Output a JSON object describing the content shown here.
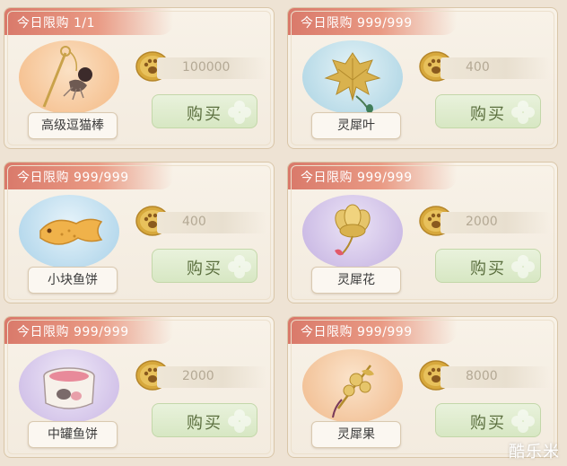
{
  "colors": {
    "ribbon": "#d9796a",
    "buy_button": "#d7e7c3",
    "coin": "#d7a83c",
    "price_text": "#b4a995"
  },
  "buy_label": "购买",
  "items": [
    {
      "limit": "今日限购 1/1",
      "name": "高级逗猫棒",
      "price": "100000",
      "icon": "cat-teaser-wand-icon",
      "bg": "#f6c79a"
    },
    {
      "limit": "今日限购 999/999",
      "name": "灵犀叶",
      "price": "400",
      "icon": "golden-leaf-icon",
      "bg": "#b9dbe7"
    },
    {
      "limit": "今日限购 999/999",
      "name": "小块鱼饼",
      "price": "400",
      "icon": "fish-cake-icon",
      "bg": "#bcdcec"
    },
    {
      "limit": "今日限购 999/999",
      "name": "灵犀花",
      "price": "2000",
      "icon": "golden-flower-icon",
      "bg": "#cbbbe3"
    },
    {
      "limit": "今日限购 999/999",
      "name": "中罐鱼饼",
      "price": "2000",
      "icon": "fish-can-icon",
      "bg": "#d2c3e8"
    },
    {
      "limit": "今日限购 999/999",
      "name": "灵犀果",
      "price": "8000",
      "icon": "golden-fruit-branch-icon",
      "bg": "#f2c49b"
    }
  ],
  "watermark": "酷乐米"
}
